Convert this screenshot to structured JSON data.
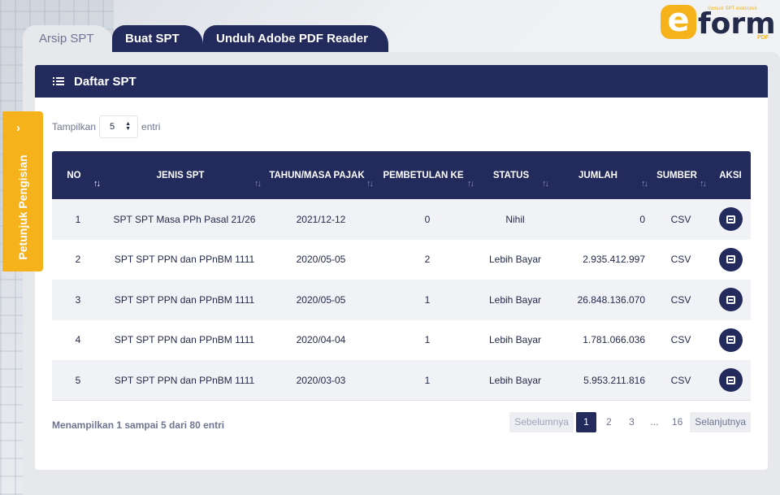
{
  "logo": {
    "letter": "e",
    "word": "form",
    "tagline": "formulir SPT elektronik",
    "pdf": "PDF"
  },
  "tabs": [
    {
      "label": "Arsip SPT"
    },
    {
      "label": "Buat SPT"
    },
    {
      "label": "Unduh Adobe PDF Reader"
    }
  ],
  "card": {
    "title": "Daftar SPT"
  },
  "length": {
    "prefix": "Tampilkan",
    "value": "5",
    "suffix": "entri"
  },
  "table": {
    "headers": [
      "NO",
      "JENIS SPT",
      "TAHUN/MASA PAJAK",
      "PEMBETULAN KE",
      "STATUS",
      "JUMLAH",
      "SUMBER",
      "AKSI"
    ],
    "rows": [
      [
        "1",
        "SPT SPT Masa PPh Pasal 21/26",
        "2021/12-12",
        "0",
        "Nihil",
        "0",
        "CSV"
      ],
      [
        "2",
        "SPT SPT PPN dan PPnBM 1111",
        "2020/05-05",
        "2",
        "Lebih Bayar",
        "2.935.412.997",
        "CSV"
      ],
      [
        "3",
        "SPT SPT PPN dan PPnBM 1111",
        "2020/05-05",
        "1",
        "Lebih Bayar",
        "26.848.136.070",
        "CSV"
      ],
      [
        "4",
        "SPT SPT PPN dan PPnBM 1111",
        "2020/04-04",
        "1",
        "Lebih Bayar",
        "1.781.066.036",
        "CSV"
      ],
      [
        "5",
        "SPT SPT PPN dan PPnBM 1111",
        "2020/03-03",
        "1",
        "Lebih Bayar",
        "5.953.211.816",
        "CSV"
      ]
    ]
  },
  "info": "Menampilkan 1 sampai 5 dari 80 entri",
  "pagination": {
    "prev": "Sebelumnya",
    "pages": [
      "1",
      "2",
      "3",
      "...",
      "16"
    ],
    "next": "Selanjutnya",
    "active": "1"
  },
  "guide": {
    "label": "Petunjuk Pengisian"
  },
  "colors": {
    "navy": "#232a5c",
    "accent": "#f6b21a"
  }
}
